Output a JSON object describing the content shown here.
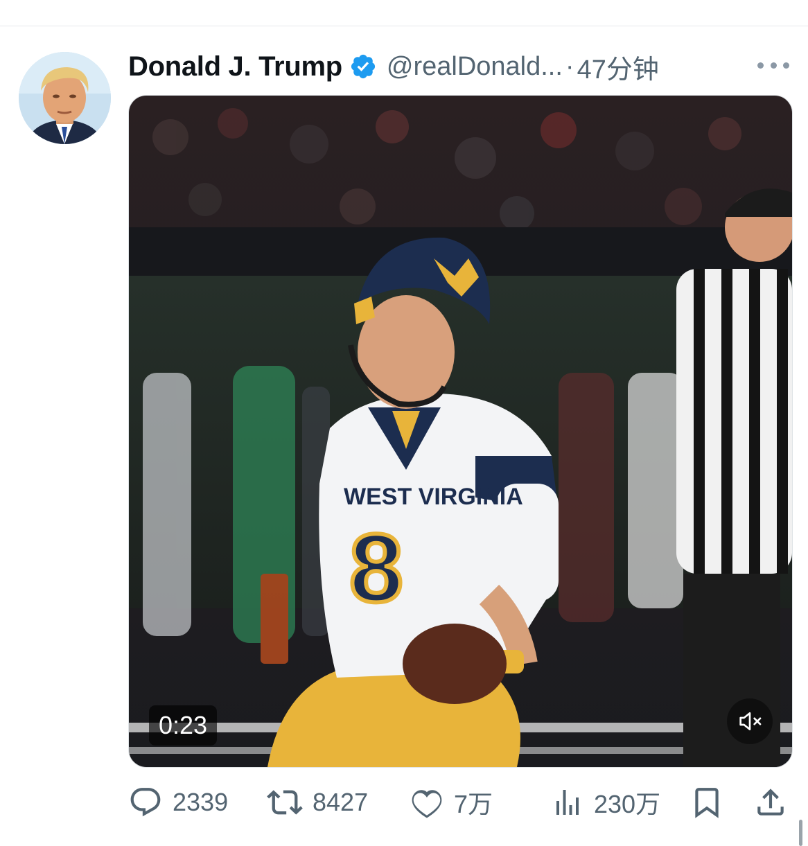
{
  "tweet": {
    "author": {
      "name": "Donald J. Trump",
      "handle": "@realDonald...",
      "verified": true
    },
    "separator": "·",
    "time": "47分钟",
    "media": {
      "type": "video",
      "duration": "0:23",
      "muted": true,
      "jersey_text": "WEST VIRGINIA",
      "jersey_number": "8"
    },
    "actions": {
      "replies": "2339",
      "retweets": "8427",
      "likes": "7万",
      "views": "230万"
    }
  },
  "colors": {
    "verified": "#1d9bf0",
    "secondary_text": "#536471",
    "icon": "#536471"
  },
  "icons": [
    "verified-badge-icon",
    "more-icon",
    "mute-icon",
    "reply-icon",
    "retweet-icon",
    "like-icon",
    "views-icon",
    "bookmark-icon",
    "share-icon"
  ]
}
